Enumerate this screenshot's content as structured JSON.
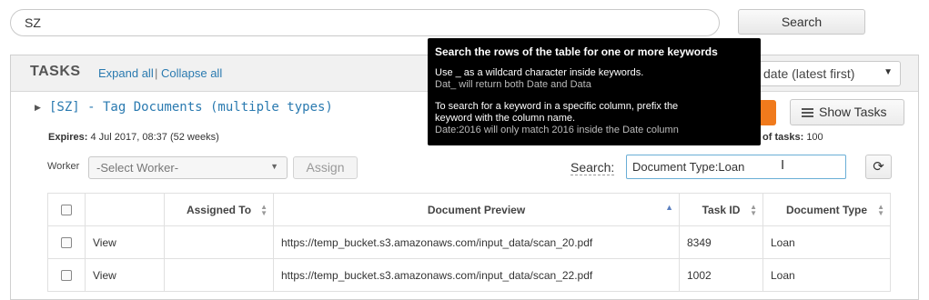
{
  "top_search": {
    "value": "SZ",
    "button_label": "Search"
  },
  "tasks_header": {
    "title": "TASKS",
    "expand_all": "Expand all",
    "separator": "|",
    "collapse_all": "Collapse all",
    "sort_select_value": "date (latest first)"
  },
  "tag": {
    "title": "[SZ] - Tag Documents (multiple types)",
    "expires_label": "Expires:",
    "expires_value": "4 Jul 2017, 08:37 (52 weeks)",
    "num_tasks_label": "of tasks:",
    "num_tasks_value": "100",
    "show_tasks_label": "Show Tasks"
  },
  "worker": {
    "label": "Worker",
    "select_placeholder": "-Select Worker-",
    "assign_label": "Assign"
  },
  "table_search": {
    "label": "Search:",
    "value": "Document Type:Loan"
  },
  "table": {
    "headers": [
      "",
      "",
      "Assigned To",
      "Document Preview",
      "Task ID",
      "Document Type"
    ],
    "rows": [
      {
        "action": "View",
        "assigned_to": "",
        "preview": "https://temp_bucket.s3.amazonaws.com/input_data/scan_20.pdf",
        "task_id": "8349",
        "doc_type": "Loan"
      },
      {
        "action": "View",
        "assigned_to": "",
        "preview": "https://temp_bucket.s3.amazonaws.com/input_data/scan_22.pdf",
        "task_id": "1002",
        "doc_type": "Loan"
      }
    ]
  },
  "tooltip": {
    "title": "Search the rows of the table for one or more keywords",
    "line1": "Use _ as a wildcard character inside keywords.",
    "example1": "Dat_ will return both Date and Data",
    "line2a": "To search for a keyword in a specific column, prefix the",
    "line2b": "keyword with the column name.",
    "example2": "Date:2016 will only match 2016 inside the Date column"
  },
  "colors": {
    "link": "#2a7ab0",
    "accent": "#f07a1c",
    "tooltip_bg": "#000000"
  },
  "icons": [
    "caret-right-icon",
    "list-icon",
    "refresh-icon",
    "sort-icon",
    "sort-asc-icon",
    "text-cursor-icon",
    "chevron-down-icon"
  ]
}
